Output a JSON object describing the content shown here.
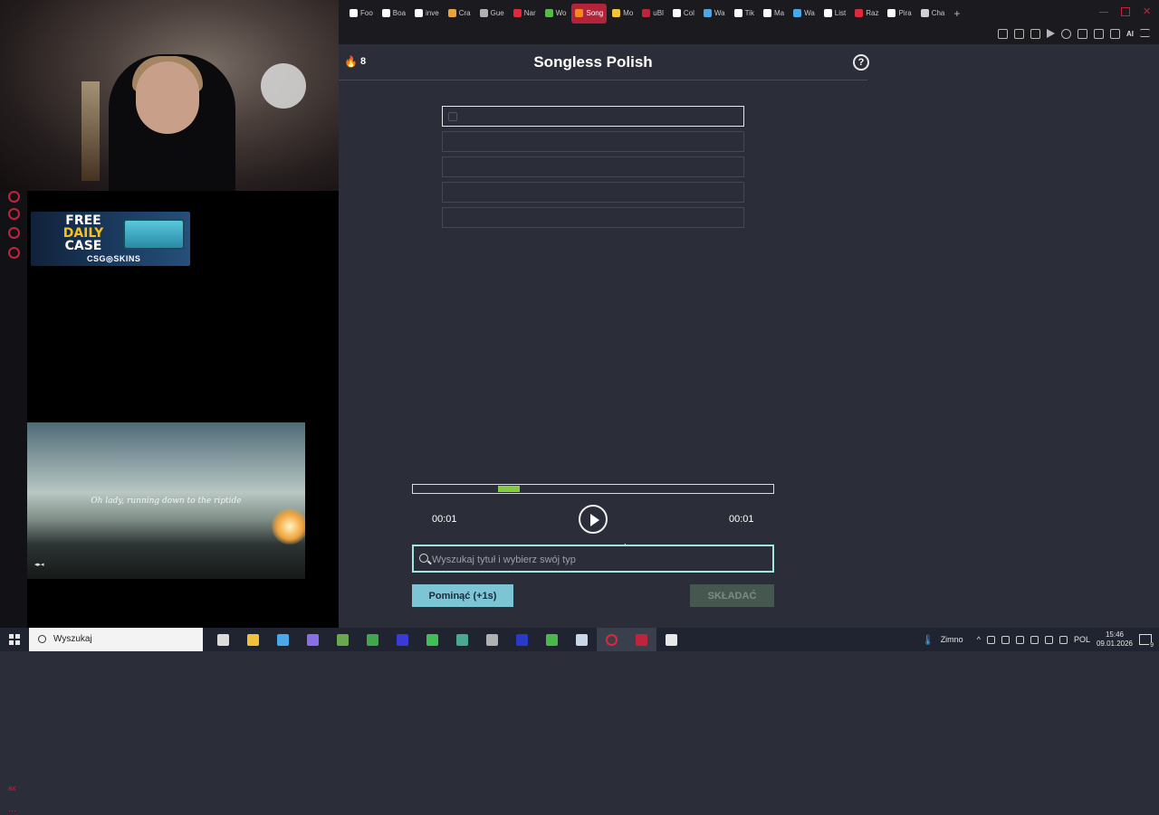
{
  "browser": {
    "tabs": [
      {
        "label": "Foo",
        "color": "#ffffff"
      },
      {
        "label": "Boa",
        "color": "#ffffff"
      },
      {
        "label": "inve",
        "color": "#ffffff"
      },
      {
        "label": "Cra",
        "color": "#e8a43a"
      },
      {
        "label": "Gue",
        "color": "#b0b0b0"
      },
      {
        "label": "Nar",
        "color": "#e0283c"
      },
      {
        "label": "Wo",
        "color": "#59b94a"
      },
      {
        "label": "Song",
        "color": "#f28a1b",
        "active": true
      },
      {
        "label": "Mo",
        "color": "#f0c43a"
      },
      {
        "label": "uBl",
        "color": "#c0243a"
      },
      {
        "label": "Col",
        "color": "#ffffff"
      },
      {
        "label": "Wa",
        "color": "#4aa8e8"
      },
      {
        "label": "Tik",
        "color": "#ffffff"
      },
      {
        "label": "Ma",
        "color": "#ffffff"
      },
      {
        "label": "Wa",
        "color": "#4aa8e8"
      },
      {
        "label": "List",
        "color": "#ffffff"
      },
      {
        "label": "Raz",
        "color": "#e0283c"
      },
      {
        "label": "Pira",
        "color": "#ffffff"
      },
      {
        "label": "Cha",
        "color": "#d0d0d0"
      }
    ],
    "new_tab": "+",
    "toolbar_ai": "AI"
  },
  "overlay": {
    "ad_title_line1": "FREE",
    "ad_title_line2": "DAILY",
    "ad_title_line3": "CASE",
    "ad_brand": "CSG◎SKINS",
    "video_lyric": "Oh lady, running down to the riptide",
    "video_mark": "◂▸◂",
    "strip_foot1": "ax",
    "strip_foot2": "···"
  },
  "game": {
    "streak": "8",
    "title": "Songless Polish",
    "help": "?",
    "guess_count": 5,
    "progress_fraction": 0.06,
    "time_left": "00:01",
    "time_right": "00:01",
    "search_placeholder": "Wyszukaj tytuł i wybierz swój typ",
    "skip_label": "Pominąć (+1s)",
    "submit_label": "SKŁADAĆ"
  },
  "taskbar": {
    "search_text": "Wyszukaj",
    "weather": "Zimno",
    "language": "POL",
    "time": "15:46",
    "date": "09.01.2026",
    "notifications": "9",
    "app_colors": [
      "#dcdcdc",
      "#f0c23a",
      "#4aa8e8",
      "#8a6ee8",
      "#6aa84f",
      "#3ea84a",
      "#3a3ad8",
      "#3fbf55",
      "#4aa890",
      "#b0b0b0",
      "#2a3ac8",
      "#4ab84a",
      "#c8d8e8",
      "#e0283c",
      "#c0243a",
      "#e8e8e8"
    ]
  },
  "colors": {
    "accent": "#9fe8e4",
    "skip": "#7bc5d5",
    "progress": "#82ce3c",
    "active_tab": "#b3233a"
  }
}
